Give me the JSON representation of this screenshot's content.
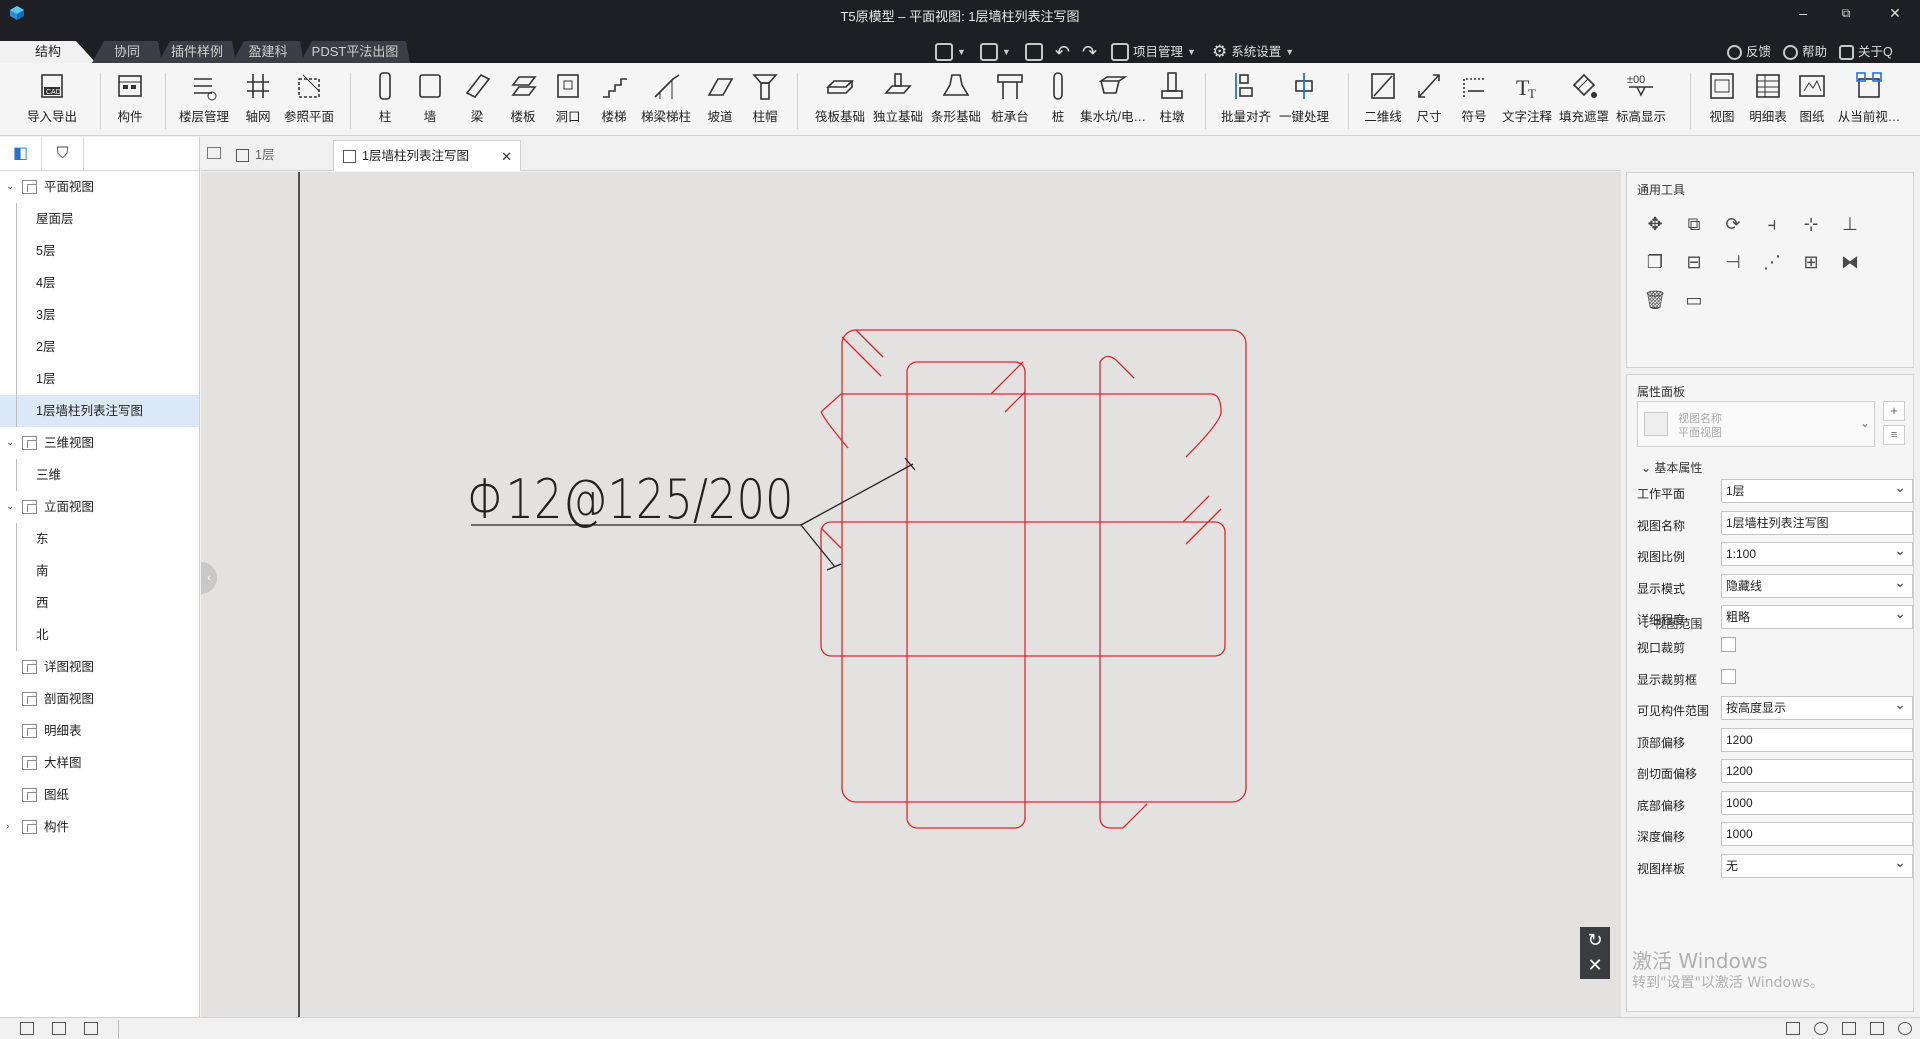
{
  "window": {
    "title": "T5原模型 – 平面视图: 1层墙柱列表注写图",
    "min": "–",
    "max": "⧉",
    "close": "✕"
  },
  "main_tabs": [
    "结构",
    "协同",
    "插件样例",
    "盈建科",
    "PDST平法出图"
  ],
  "quick_access": {
    "project_mgmt": "项目管理",
    "system_settings": "系统设置"
  },
  "top_right": {
    "feedback": "反馈",
    "help": "帮助",
    "about": "关于Q"
  },
  "ribbon": {
    "import_export": "导入导出",
    "component": "构件",
    "floor_mgmt": "楼层管理",
    "axis_grid": "轴网",
    "ref_plane": "参照平面",
    "column": "柱",
    "wall": "墙",
    "beam": "梁",
    "slab": "楼板",
    "opening": "洞口",
    "stair": "楼梯",
    "stair_beam_col": "梯梁梯柱",
    "ramp": "坡道",
    "column_cap": "柱帽",
    "raft_found": "筏板基础",
    "iso_found": "独立基础",
    "strip_found": "条形基础",
    "pile_cap": "桩承台",
    "pile": "桩",
    "sump_pit": "集水坑/电…",
    "pier": "柱墩",
    "batch_align": "批量对齐",
    "one_key": "一键处理",
    "line_2d": "二维线",
    "dimension": "尺寸",
    "symbol": "符号",
    "text_note": "文字注释",
    "fill_mask": "填充遮罩",
    "elev_disp": "标高显示",
    "view": "视图",
    "schedule": "明细表",
    "drawing": "图纸",
    "from_current": "从当前视…"
  },
  "left_panel": {
    "tree": [
      {
        "label": "平面视图",
        "level": 0,
        "expand": "⌄"
      },
      {
        "label": "屋面层",
        "level": 1
      },
      {
        "label": "5层",
        "level": 1
      },
      {
        "label": "4层",
        "level": 1
      },
      {
        "label": "3层",
        "level": 1
      },
      {
        "label": "2层",
        "level": 1
      },
      {
        "label": "1层",
        "level": 1
      },
      {
        "label": "1层墙柱列表注写图",
        "level": 1,
        "selected": true
      },
      {
        "label": "三维视图",
        "level": 0,
        "expand": "⌄"
      },
      {
        "label": "三维",
        "level": 1
      },
      {
        "label": "立面视图",
        "level": 0,
        "expand": "⌄"
      },
      {
        "label": "东",
        "level": 1
      },
      {
        "label": "南",
        "level": 1
      },
      {
        "label": "西",
        "level": 1
      },
      {
        "label": "北",
        "level": 1
      },
      {
        "label": "详图视图",
        "level": 0
      },
      {
        "label": "剖面视图",
        "level": 0
      },
      {
        "label": "明细表",
        "level": 0
      },
      {
        "label": "大样图",
        "level": 0
      },
      {
        "label": "图纸",
        "level": 0
      },
      {
        "label": "构件",
        "level": 0,
        "expand": "›"
      }
    ]
  },
  "doc_tabs": {
    "tab1": "1层",
    "tab2": "1层墙柱列表注写图",
    "close": "✕"
  },
  "canvas": {
    "rebar_label": "Φ12@125/200",
    "stroke_color": "#e0262b"
  },
  "right_panel": {
    "tools_title": "通用工具",
    "props_title": "属性面板",
    "type_name": "视图名称",
    "type_sub": "平面视图",
    "group_basic": "基本属性",
    "group_range": "视图范围",
    "props": [
      {
        "label": "工作平面",
        "value": "1层",
        "kind": "dropdown"
      },
      {
        "label": "视图名称",
        "value": "1层墙柱列表注写图",
        "kind": "text"
      },
      {
        "label": "视图比例",
        "value": "1:100",
        "kind": "dropdown"
      },
      {
        "label": "显示模式",
        "value": "隐藏线",
        "kind": "dropdown"
      },
      {
        "label": "详细程度",
        "value": "粗略",
        "kind": "dropdown"
      }
    ],
    "range_props": [
      {
        "label": "视口裁剪",
        "kind": "checkbox"
      },
      {
        "label": "显示裁剪框",
        "kind": "checkbox"
      },
      {
        "label": "可见构件范围",
        "value": "按高度显示",
        "kind": "dropdown"
      },
      {
        "label": "顶部偏移",
        "value": "1200",
        "kind": "text"
      },
      {
        "label": "剖切面偏移",
        "value": "1200",
        "kind": "text"
      },
      {
        "label": "底部偏移",
        "value": "1000",
        "kind": "text"
      },
      {
        "label": "深度偏移",
        "value": "1000",
        "kind": "text"
      },
      {
        "label": "视图样板",
        "value": "无",
        "kind": "dropdown"
      }
    ]
  },
  "watermark": {
    "line1": "激活 Windows",
    "line2": "转到\"设置\"以激活 Windows。"
  }
}
